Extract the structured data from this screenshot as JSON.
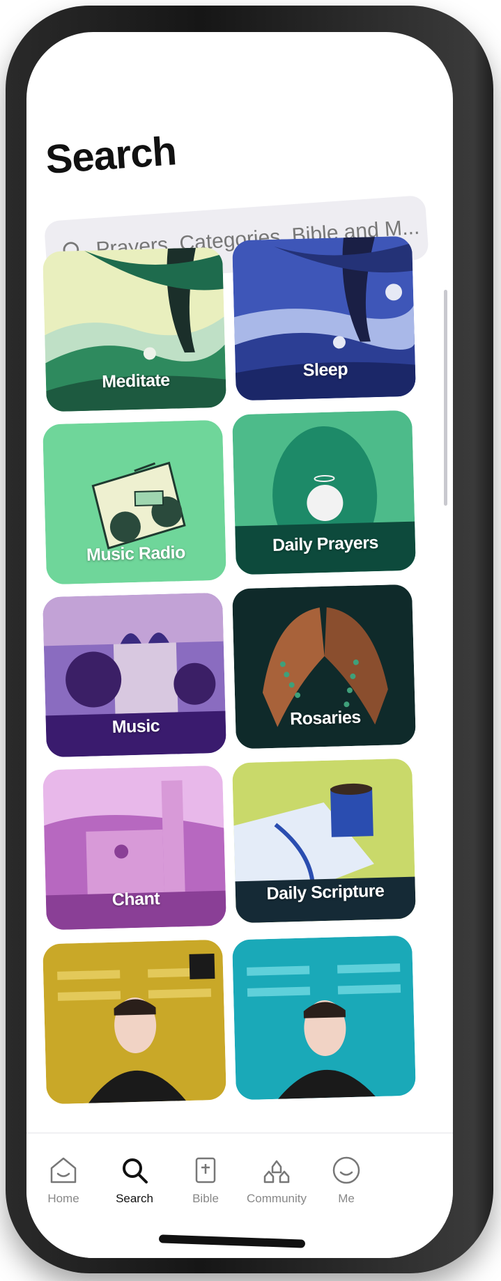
{
  "header": {
    "title": "Search"
  },
  "search": {
    "placeholder": "Prayers, Categories, Bible and M..."
  },
  "tiles": [
    {
      "label": "Meditate"
    },
    {
      "label": "Sleep"
    },
    {
      "label": "Music Radio"
    },
    {
      "label": "Daily Prayers"
    },
    {
      "label": "Music"
    },
    {
      "label": "Rosaries"
    },
    {
      "label": "Chant"
    },
    {
      "label": "Daily Scripture"
    },
    {
      "label": ""
    },
    {
      "label": ""
    }
  ],
  "tabs": [
    {
      "label": "Home",
      "icon": "home-icon"
    },
    {
      "label": "Search",
      "icon": "search-icon"
    },
    {
      "label": "Bible",
      "icon": "bible-icon"
    },
    {
      "label": "Community",
      "icon": "community-icon"
    },
    {
      "label": "Me",
      "icon": "me-icon"
    }
  ],
  "active_tab": "Search",
  "colors": {
    "search_bg": "#eeedf2",
    "meditate": "#2e8a5e",
    "sleep": "#2c3e94",
    "music_radio": "#6fd69a",
    "daily_prayers": "#3aa27a",
    "music": "#5a2f8a",
    "rosaries": "#0f2a2a",
    "chant": "#b768c0",
    "daily_scripture": "#c9d96a",
    "podcast_yellow": "#c9a828",
    "podcast_teal": "#1aa9b8"
  }
}
